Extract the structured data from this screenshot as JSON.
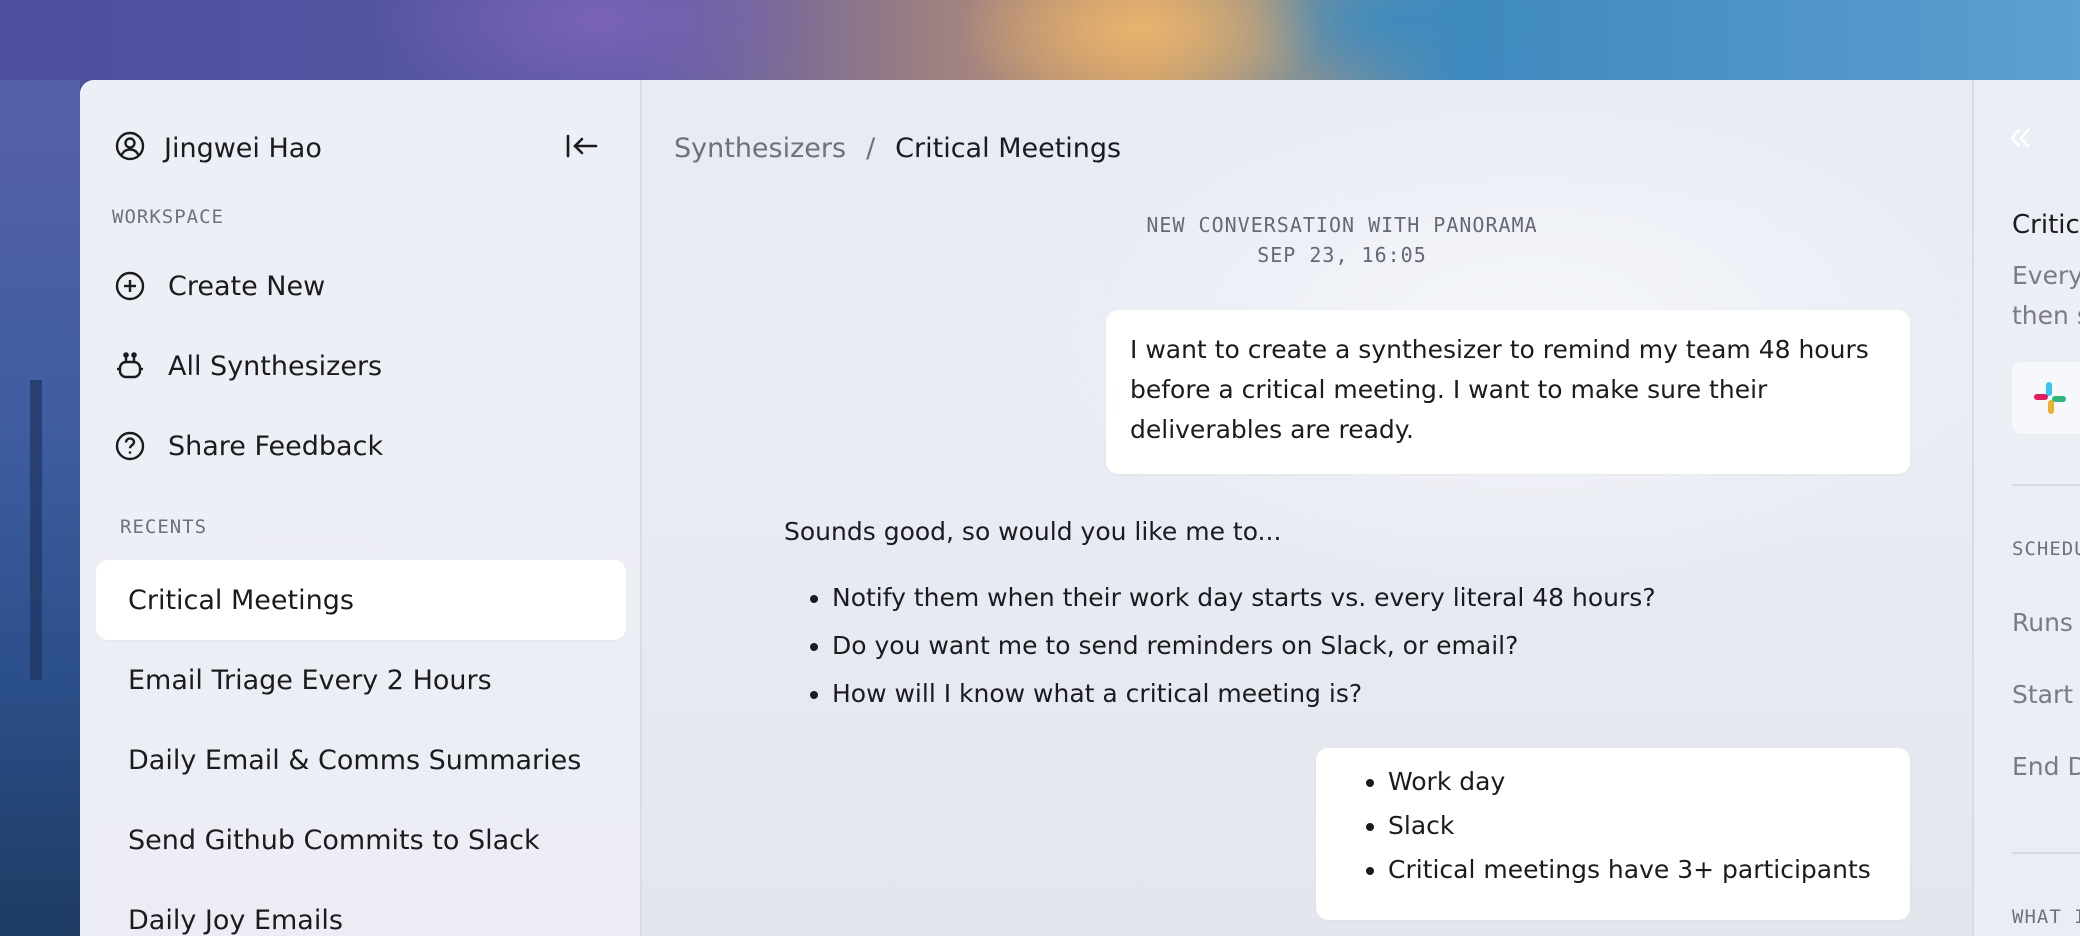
{
  "user": {
    "name": "Jingwei Hao"
  },
  "sidebar": {
    "workspace_label": "WORKSPACE",
    "workspace_items": [
      {
        "label": "Create New",
        "icon": "plus-circle-icon"
      },
      {
        "label": "All Synthesizers",
        "icon": "robot-icon"
      },
      {
        "label": "Share Feedback",
        "icon": "question-circle-icon"
      }
    ],
    "recents_label": "RECENTS",
    "recents": [
      {
        "label": "Critical Meetings",
        "active": true
      },
      {
        "label": "Email Triage Every 2 Hours"
      },
      {
        "label": "Daily Email & Comms Summaries"
      },
      {
        "label": "Send Github Commits to Slack"
      },
      {
        "label": "Daily Joy Emails"
      }
    ]
  },
  "breadcrumb": {
    "parent": "Synthesizers",
    "separator": "/",
    "current": "Critical Meetings"
  },
  "conversation": {
    "header_line1": "NEW CONVERSATION WITH PANORAMA",
    "header_line2": "SEP 23, 16:05",
    "user_message_1": "I want to create a synthesizer to remind my team 48 hours before a critical meeting. I want to make sure their deliverables are ready.",
    "assistant_reply_intro": "Sounds good, so would you like me to...",
    "assistant_questions": [
      "Notify them when their work day starts vs. every literal 48 hours?",
      "Do you want me to send reminders on Slack, or email?",
      "How will I know what a critical meeting is?"
    ],
    "user_message_2_items": [
      "Work day",
      "Slack",
      "Critical meetings have 3+ participants"
    ]
  },
  "right_panel": {
    "title": "Critic",
    "description_line1": "Every",
    "description_line2": "then s",
    "schedule_label": "SCHEDU",
    "rows": [
      "Runs",
      "Start",
      "End D"
    ],
    "what_label": "WHAT I"
  },
  "colors": {
    "accent_bg": "#ffffff",
    "muted_text": "#6f7079"
  }
}
